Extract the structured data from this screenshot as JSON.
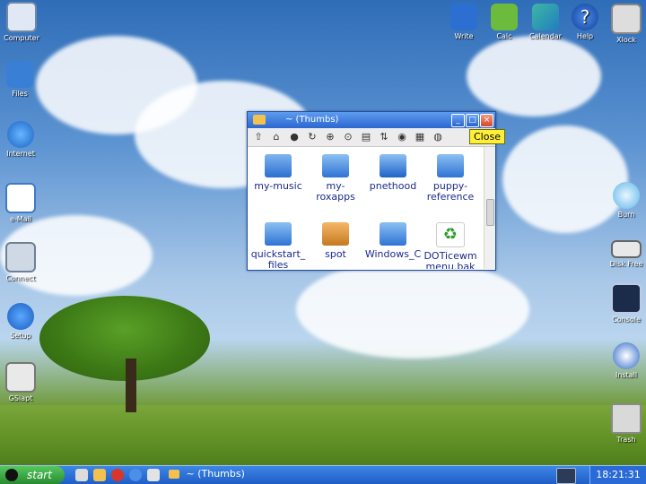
{
  "desktop": {
    "left_icons": [
      {
        "id": "computer",
        "label": "Computer"
      },
      {
        "id": "files",
        "label": "Files"
      },
      {
        "id": "internet",
        "label": "Internet"
      },
      {
        "id": "email",
        "label": "e-Mail"
      },
      {
        "id": "connect",
        "label": "Connect"
      },
      {
        "id": "setup",
        "label": "Setup"
      },
      {
        "id": "gslapt",
        "label": "GSlapt"
      }
    ],
    "top_icons": [
      {
        "id": "write",
        "label": "Write"
      },
      {
        "id": "calc",
        "label": "Calc"
      },
      {
        "id": "calendar",
        "label": "Calendar"
      },
      {
        "id": "help",
        "label": "Help"
      },
      {
        "id": "xlock",
        "label": "Xlock"
      }
    ],
    "right_icons": [
      {
        "id": "burn",
        "label": "Burn"
      },
      {
        "id": "diskfree",
        "label": "Disk Free"
      },
      {
        "id": "console",
        "label": "Console"
      },
      {
        "id": "install",
        "label": "Install"
      },
      {
        "id": "trash",
        "label": "Trash"
      }
    ]
  },
  "window": {
    "title": "~ (Thumbs)",
    "tooltip": "Close",
    "files": [
      {
        "label": "my-music",
        "icon": "speaker-folder"
      },
      {
        "label": "my-\nroxapps",
        "icon": "folder"
      },
      {
        "label": "pnethood",
        "icon": "network-folder"
      },
      {
        "label": "puppy-\nreference",
        "icon": "road-sign-folder"
      },
      {
        "label": "quickstart_\nfiles",
        "icon": "folder"
      },
      {
        "label": "spot",
        "icon": "person-folder"
      },
      {
        "label": "Windows_C",
        "icon": "windows-folder"
      },
      {
        "label": "DOTicewm\nmenu.bak",
        "icon": "recycle-file"
      }
    ]
  },
  "taskbar": {
    "start_label": "start",
    "task_label": "~ (Thumbs)",
    "clock": "18:21:31"
  },
  "colors": {
    "titlebar": "#2b66cf",
    "taskbar": "#1f5ec6",
    "start": "#278b2f",
    "tooltip": "#ffef3a"
  }
}
